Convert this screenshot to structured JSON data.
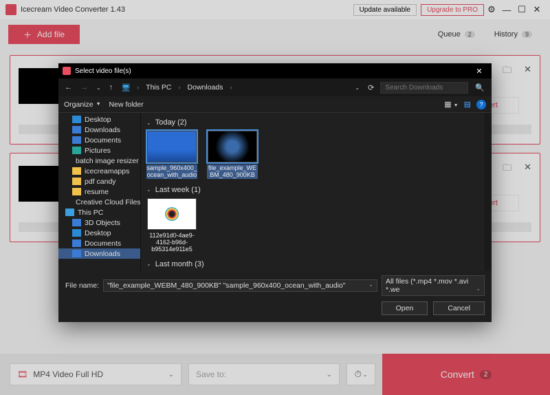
{
  "app": {
    "title": "Icecream Video Converter 1.43",
    "update_label": "Update available",
    "upgrade_label": "Upgrade to PRO"
  },
  "toolbar": {
    "add_file_label": "Add file",
    "queue_label": "Queue",
    "queue_count": "2",
    "history_label": "History",
    "history_count": "9"
  },
  "queue_items": [
    {
      "convert_label": "vert"
    },
    {
      "convert_label": "vert"
    }
  ],
  "bottom": {
    "format_label": "MP4 Video Full HD",
    "save_to_label": "Save to:",
    "convert_label": "Convert",
    "convert_count": "2"
  },
  "dialog": {
    "title": "Select video file(s)",
    "breadcrumb": [
      "This PC",
      "Downloads"
    ],
    "search_placeholder": "Search Downloads",
    "organize_label": "Organize",
    "newfolder_label": "New folder",
    "tree": [
      {
        "label": "Desktop",
        "icon": "desktop",
        "depth": 2
      },
      {
        "label": "Downloads",
        "icon": "folderb",
        "depth": 2
      },
      {
        "label": "Documents",
        "icon": "folderb",
        "depth": 2
      },
      {
        "label": "Pictures",
        "icon": "pic",
        "depth": 2
      },
      {
        "label": "batch image resizer",
        "icon": "folder",
        "depth": 3
      },
      {
        "label": "icecreamapps",
        "icon": "folder",
        "depth": 3
      },
      {
        "label": "pdf candy",
        "icon": "folder",
        "depth": 3
      },
      {
        "label": "resume",
        "icon": "folder",
        "depth": 3
      },
      {
        "label": "Creative Cloud Files Pe",
        "icon": "cc",
        "depth": 2
      },
      {
        "label": "This PC",
        "icon": "pc",
        "depth": 1
      },
      {
        "label": "3D Objects",
        "icon": "folderb",
        "depth": 2
      },
      {
        "label": "Desktop",
        "icon": "desktop",
        "depth": 2
      },
      {
        "label": "Documents",
        "icon": "folderb",
        "depth": 2
      },
      {
        "label": "Downloads",
        "icon": "folderb",
        "depth": 2,
        "selected": true
      }
    ],
    "groups": {
      "today": {
        "header": "Today (2)",
        "items": [
          {
            "name": "sample_960x400_ocean_with_audio",
            "thumb": "ocean",
            "selected": true
          },
          {
            "name": "file_example_WEBM_480_900KB",
            "thumb": "earth",
            "selected": true
          }
        ]
      },
      "lastweek": {
        "header": "Last week (1)",
        "items": [
          {
            "name": "112e91d0-4ae9-4162-b96d-b95314e911e5",
            "thumb": "doc",
            "selected": false
          }
        ]
      },
      "lastmonth": {
        "header": "Last month (3)"
      }
    },
    "filename_label": "File name:",
    "filename_value": "\"file_example_WEBM_480_900KB\" \"sample_960x400_ocean_with_audio\"",
    "filter_value": "All files (*.mp4 *.mov *.avi *.we",
    "open_label": "Open",
    "cancel_label": "Cancel"
  }
}
